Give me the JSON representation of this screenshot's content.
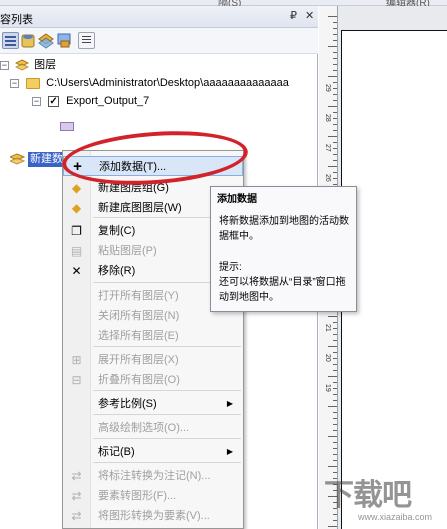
{
  "top_strip": {
    "left_fragment": "隔(S)",
    "right_fragment": "编辑器(R)"
  },
  "toc": {
    "title": "容列表",
    "controls": {
      "pin": "₽",
      "close": "✕"
    },
    "toolbar_icons": [
      "list-by-drawing-order-icon",
      "list-by-source-icon",
      "list-by-visibility-icon",
      "list-by-selection-icon",
      "options-icon"
    ],
    "tree": {
      "root_label": "图层",
      "folder_path": "C:\\Users\\Administrator\\Desktop\\aaaaaaaaaaaaaa",
      "layer_name": "Export_Output_7",
      "layer_checked": "✓",
      "new_layer_label": "新建数"
    }
  },
  "ruler": {
    "labels": [
      "29",
      "28",
      "27",
      "26",
      "25",
      "24",
      "23",
      "22",
      "21",
      "20",
      "19"
    ]
  },
  "context_menu": {
    "items": [
      {
        "label": "添加数据(T)...",
        "icon": "add-data-icon",
        "glyph": "+",
        "disabled": false,
        "highlighted": true
      },
      {
        "label": "新建图层组(G)",
        "icon": "new-group-layer-icon",
        "glyph": "◆",
        "disabled": false
      },
      {
        "label": "新建底图图层(W)",
        "icon": "new-basemap-layer-icon",
        "glyph": "◆",
        "disabled": false
      },
      {
        "label": "复制(C)",
        "icon": "copy-icon",
        "glyph": "❐",
        "disabled": false
      },
      {
        "label": "粘贴图层(P)",
        "icon": "paste-icon",
        "glyph": "▤",
        "disabled": true
      },
      {
        "label": "移除(R)",
        "icon": "remove-icon",
        "glyph": "✕",
        "disabled": false
      },
      {
        "label": "打开所有图层(Y)",
        "disabled": true
      },
      {
        "label": "关闭所有图层(N)",
        "disabled": true
      },
      {
        "label": "选择所有图层(E)",
        "disabled": true
      },
      {
        "label": "展开所有图层(X)",
        "icon": "expand-all-icon",
        "glyph": "⊞",
        "disabled": true
      },
      {
        "label": "折叠所有图层(O)",
        "icon": "collapse-all-icon",
        "glyph": "⊟",
        "disabled": true
      },
      {
        "label": "参考比例(S)",
        "disabled": false,
        "submenu": true
      },
      {
        "label": "高级绘制选项(O)...",
        "disabled": true
      },
      {
        "label": "标记(B)",
        "disabled": false,
        "submenu": true
      },
      {
        "label": "将标注转换为注记(N)...",
        "icon": "convert-labels-icon",
        "glyph": "⇄",
        "disabled": true
      },
      {
        "label": "要素转图形(F)...",
        "icon": "features-to-graphics-icon",
        "glyph": "⇄",
        "disabled": true
      },
      {
        "label": "将图形转换为要素(V)...",
        "icon": "graphics-to-features-icon",
        "glyph": "⇄",
        "disabled": true
      }
    ],
    "submenu_arrow": "▶"
  },
  "tooltip": {
    "title": "添加数据",
    "body": "将新数据添加到地图的活动数据框中。",
    "hint_label": "提示:",
    "hint_body": "还可以将数据从“目录”窗口拖动到地图中。"
  },
  "watermark": {
    "text": "下载吧",
    "subtext": "www.xiazaiba.com"
  },
  "colors": {
    "selection": "#3a63c8",
    "menu_highlight": "#d8e6f8",
    "annotation_ring": "#d2232a"
  }
}
